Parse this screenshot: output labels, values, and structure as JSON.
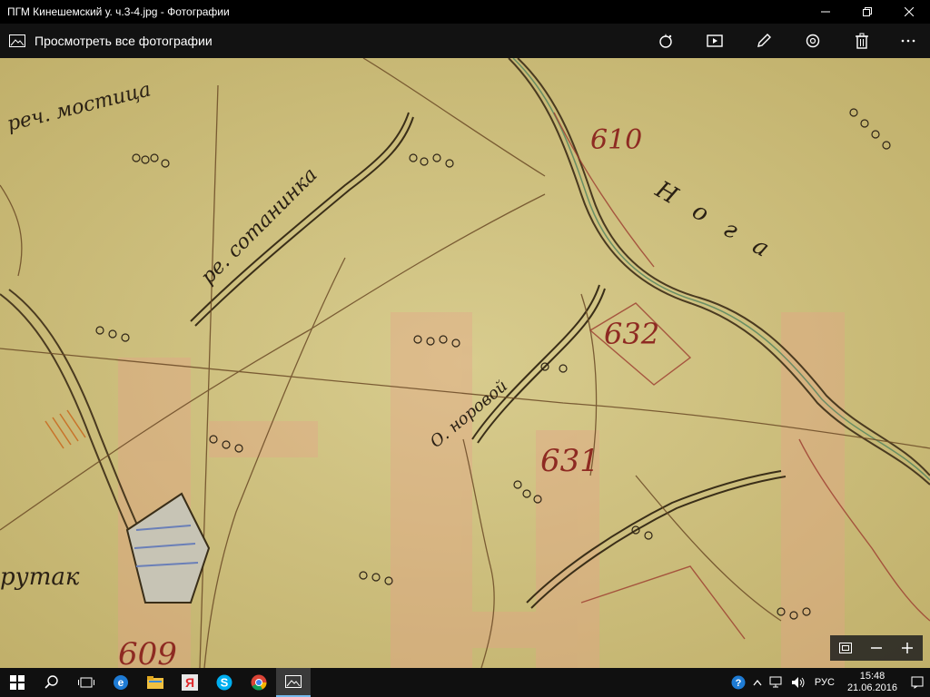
{
  "window": {
    "title": "ПГМ Кинешемский у. ч.3-4.jpg - Фотографии",
    "controls": [
      "minimize-icon",
      "maximize-icon",
      "close-icon"
    ]
  },
  "appbar": {
    "back_label": "Просмотреть все фотографии",
    "tools": [
      "enhance-icon",
      "slideshow-icon",
      "edit-icon",
      "rotate-icon",
      "delete-icon",
      "more-icon"
    ]
  },
  "map": {
    "labels": {
      "river_mostica": "реч. мостица",
      "river_sotaninka": "ре. сотанинка",
      "number_610": "610",
      "number_632": "632",
      "number_631": "631",
      "number_609": "609",
      "river_nogi": "Нога",
      "stream_left": "О. норовой",
      "krutak": "рутак"
    }
  },
  "zoom": {
    "controls": [
      "fit-screen-icon",
      "zoom-out-icon",
      "zoom-in-icon"
    ]
  },
  "taskbar": {
    "apps": [
      "windows-start-icon",
      "search-icon",
      "task-view-icon",
      "edge-icon",
      "explorer-icon",
      "yandex-icon",
      "skype-icon",
      "chrome-icon",
      "photos-icon"
    ],
    "tray": {
      "language": "РУС",
      "time": "15:48",
      "date": "21.06.2016"
    }
  }
}
